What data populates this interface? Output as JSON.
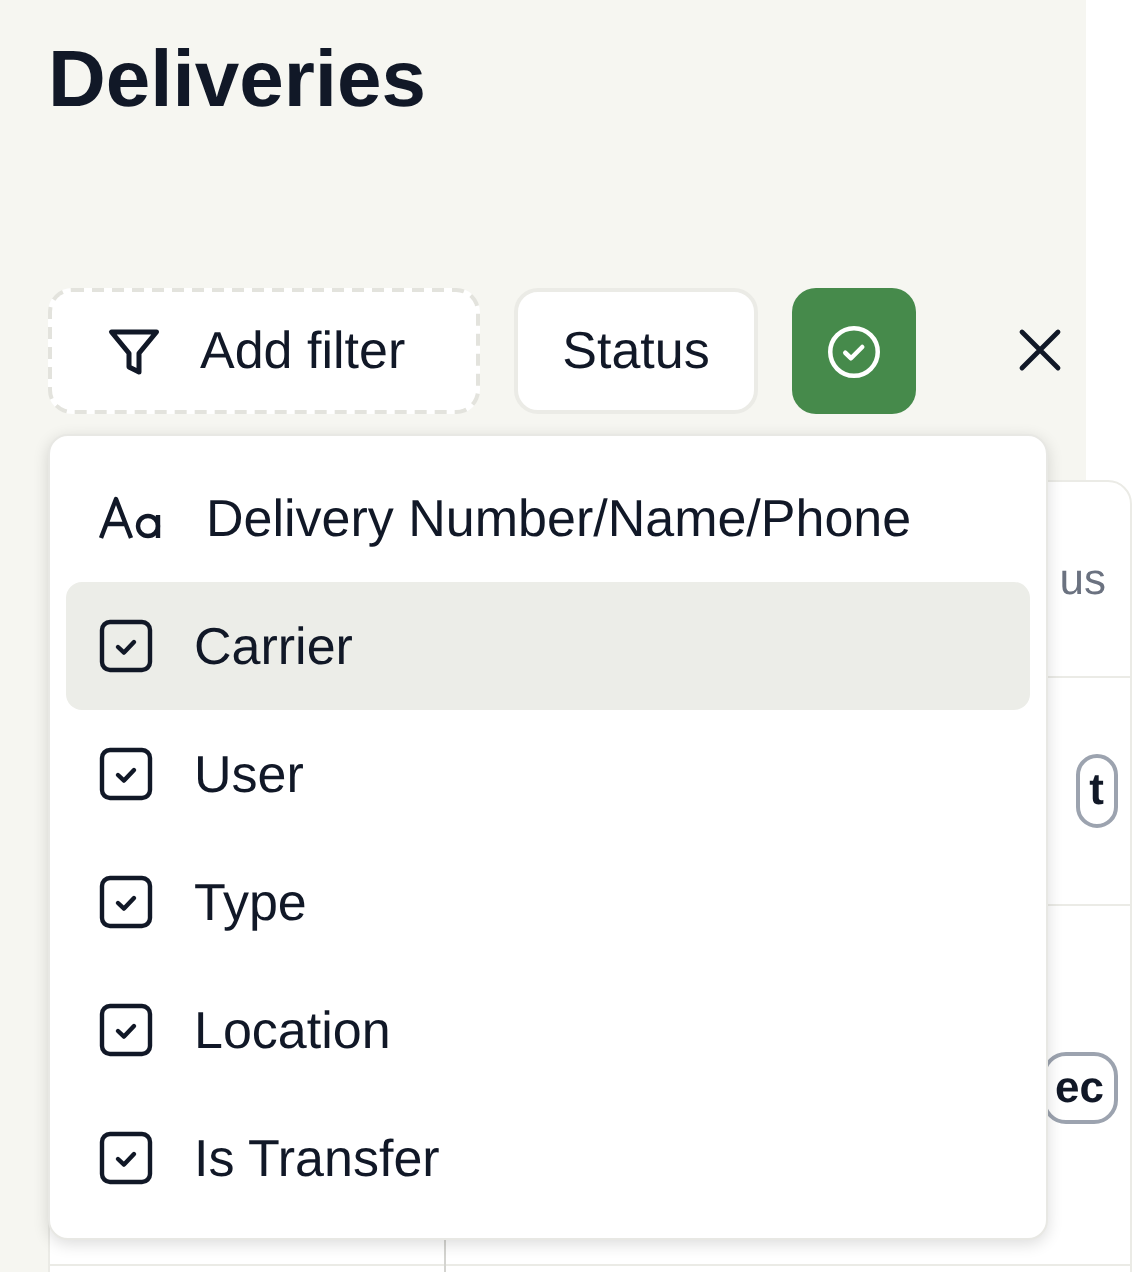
{
  "page": {
    "title": "Deliveries"
  },
  "toolbar": {
    "add_filter": "Add filter",
    "filters": [
      {
        "label": "Status",
        "kind": "chip"
      }
    ],
    "apply_selected": true
  },
  "table": {
    "header_fragment": "us",
    "rows": [
      {
        "fragment": "t"
      },
      {
        "fragment": "ec"
      }
    ]
  },
  "filter_menu": {
    "items": [
      {
        "label": "Delivery Number/Name/Phone",
        "kind": "text",
        "selected": false
      },
      {
        "label": "Carrier",
        "kind": "boolean",
        "selected": true
      },
      {
        "label": "User",
        "kind": "boolean",
        "selected": false
      },
      {
        "label": "Type",
        "kind": "boolean",
        "selected": false
      },
      {
        "label": "Location",
        "kind": "boolean",
        "selected": false
      },
      {
        "label": "Is Transfer",
        "kind": "boolean",
        "selected": false
      }
    ]
  }
}
